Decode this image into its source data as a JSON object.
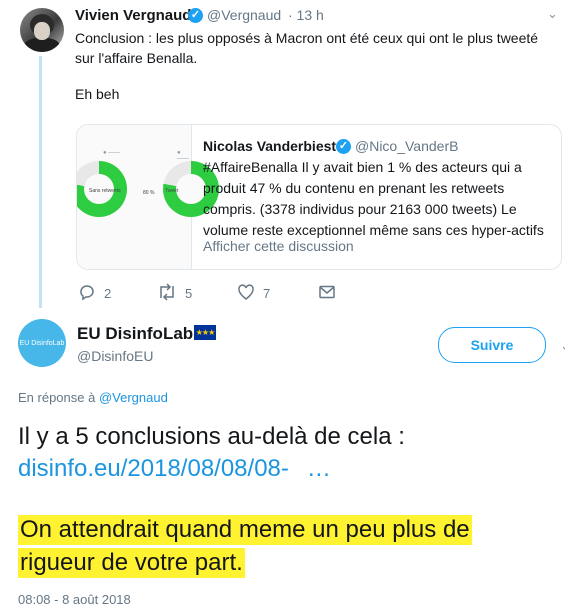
{
  "parent": {
    "name": "Vivien Vergnaud",
    "handle": "@Vergnaud",
    "time": "· 13 h",
    "text": "Conclusion : les plus opposés à Macron ont été ceux qui ont le plus tweeté sur l'affaire Benalla.",
    "text2": "Eh beh"
  },
  "quote": {
    "name": "Nicolas Vanderbiest",
    "handle": "@Nico_VanderB",
    "text": "#AffaireBenalla Il y avait bien 1 % des acteurs qui a produit 47 % du contenu en prenant les retweets compris. (3378 individus pour 2163 000 tweets) Le volume reste exceptionnel même sans ces hyper-actifs",
    "link": "Afficher cette discussion",
    "image_labels": [
      "Sans retweets",
      "80 %",
      "Tweet"
    ]
  },
  "actions": {
    "reply_count": "2",
    "retweet_count": "5",
    "like_count": "7"
  },
  "tweet": {
    "name": "EU DisinfoLab",
    "handle": "@DisinfoEU",
    "avatar_text": "EU DisinfoLab",
    "follow_label": "Suivre",
    "reply_prefix": "En réponse à",
    "reply_to": "@Vergnaud",
    "line1": "Il y a 5 conclusions au-delà de cela :",
    "link": "disinfo.eu/2018/08/08/08-",
    "link_ellipsis": "…",
    "highlight1": "On attendrait quand meme un peu plus de",
    "highlight2": "rigueur de votre part.",
    "date": "08:08 - 8 août 2018"
  },
  "colors": {
    "accent": "#1da1f2",
    "highlight": "#fff230",
    "thread_line": "#c4e2f5",
    "secondary_text": "#657786"
  }
}
